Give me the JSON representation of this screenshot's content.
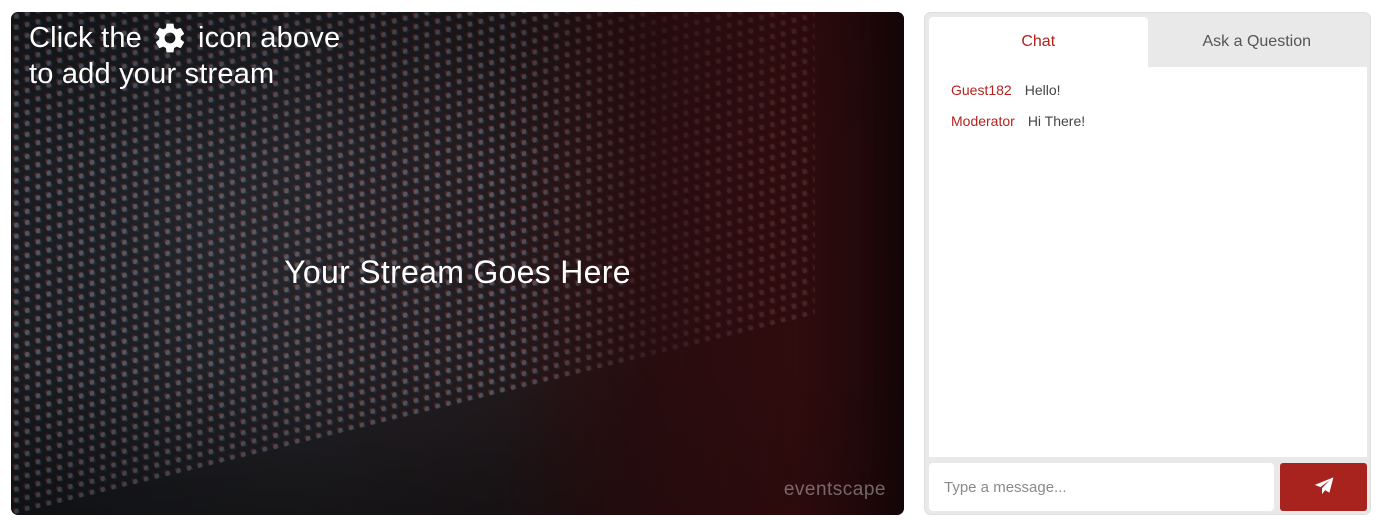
{
  "stream": {
    "hint_before_icon": "Click the",
    "hint_icon": "gear-icon",
    "hint_after_icon": "icon above",
    "hint_line2": "to add your stream",
    "placeholder": "Your Stream Goes Here",
    "brand": "eventscape"
  },
  "chat": {
    "tabs": [
      {
        "label": "Chat",
        "active": true
      },
      {
        "label": "Ask a Question",
        "active": false
      }
    ],
    "messages": [
      {
        "user": "Guest182",
        "text": "Hello!"
      },
      {
        "user": "Moderator",
        "text": "Hi There!"
      }
    ],
    "input": {
      "placeholder": "Type a message...",
      "value": ""
    },
    "send_icon": "send-icon"
  },
  "colors": {
    "accent": "#b3231f",
    "send_button": "#a8231d",
    "panel_bg": "#e9e9e9"
  }
}
